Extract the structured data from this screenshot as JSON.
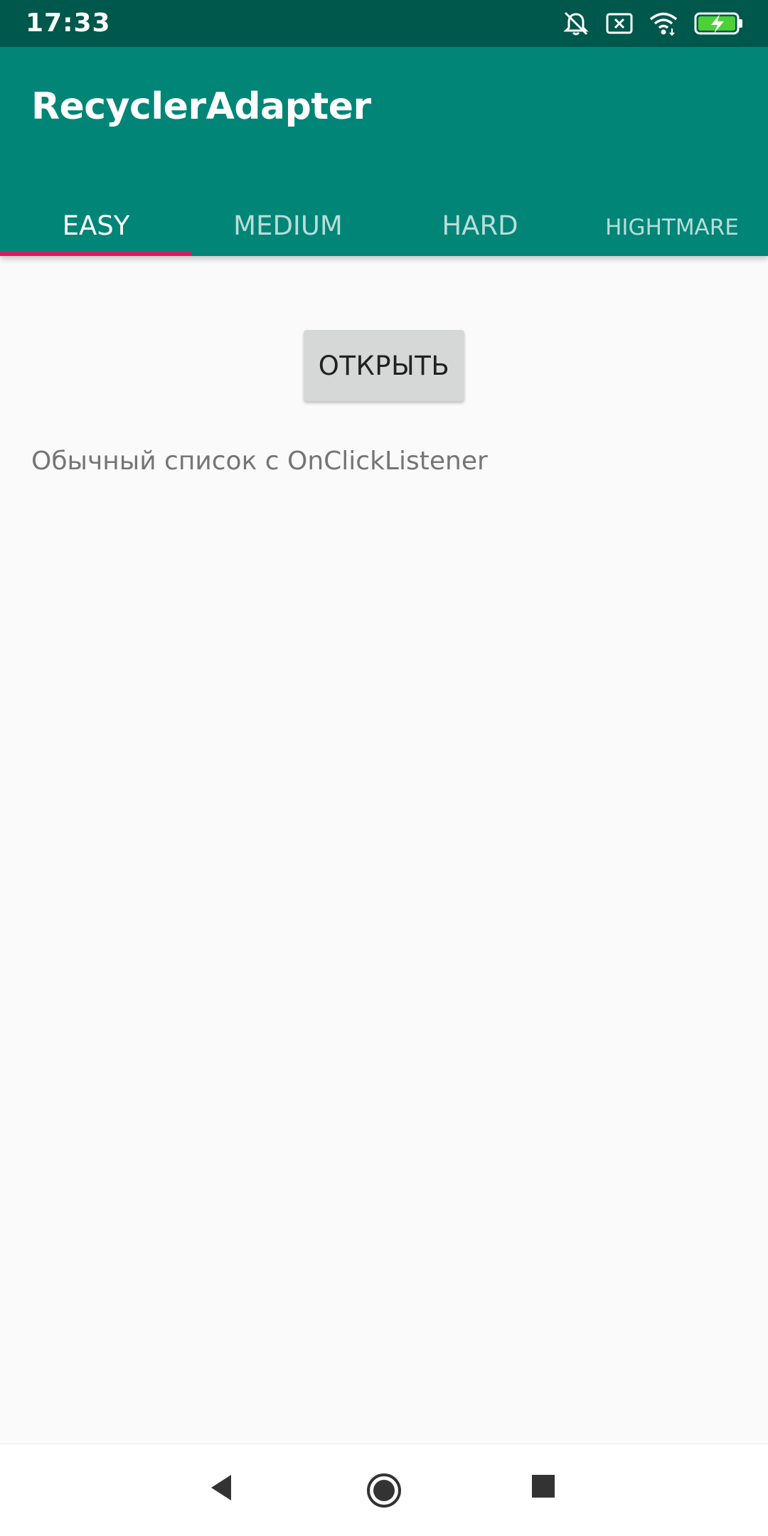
{
  "status_bar": {
    "time": "17:33",
    "icons": [
      "bell-off-icon",
      "sim-x-icon",
      "wifi-icon",
      "battery-charging-icon"
    ]
  },
  "app_bar": {
    "title": "RecyclerAdapter",
    "tabs": [
      {
        "label": "EASY",
        "active": true
      },
      {
        "label": "MEDIUM",
        "active": false
      },
      {
        "label": "HARD",
        "active": false
      },
      {
        "label": "HIGHTMARE",
        "active": false
      }
    ]
  },
  "main": {
    "open_button_label": "ОТКРЫТЬ",
    "description": "Обычный список с OnClickListener"
  },
  "nav_bar": {
    "icons": [
      "back-icon",
      "home-icon",
      "recents-icon"
    ]
  },
  "colors": {
    "status_bar": "#00574b",
    "primary": "#008577",
    "accent": "#d81b60",
    "background": "#fafafa"
  }
}
